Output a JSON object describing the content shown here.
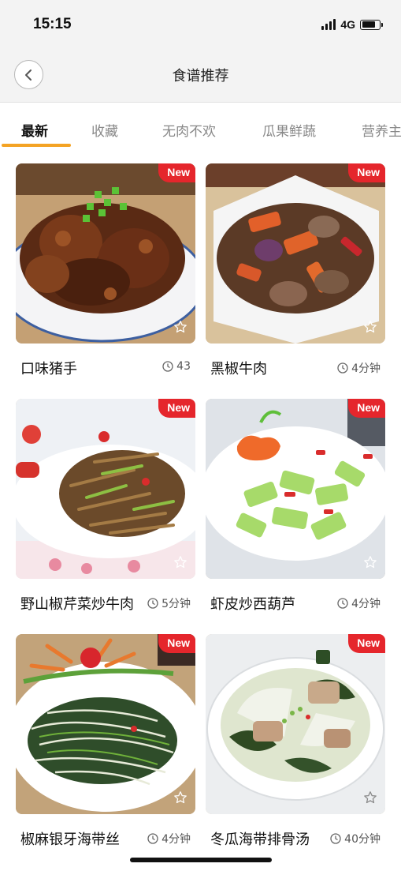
{
  "status": {
    "time": "15:15",
    "network": "4G"
  },
  "nav": {
    "title": "食谱推荐"
  },
  "tabs": [
    "最新",
    "收藏",
    "无肉不欢",
    "瓜果鲜蔬",
    "营养主"
  ],
  "badge_label": "New",
  "colors": {
    "accent": "#f4a324",
    "badge": "#e5262c"
  },
  "recipes": [
    {
      "name": "口味猪手",
      "time": "43"
    },
    {
      "name": "黑椒牛肉",
      "time": "4分钟"
    },
    {
      "name": "野山椒芹菜炒牛肉",
      "time": "5分钟"
    },
    {
      "name": "虾皮炒西葫芦",
      "time": "4分钟"
    },
    {
      "name": "椒麻银牙海带丝",
      "time": "4分钟"
    },
    {
      "name": "冬瓜海带排骨汤",
      "time": "40分钟"
    }
  ]
}
